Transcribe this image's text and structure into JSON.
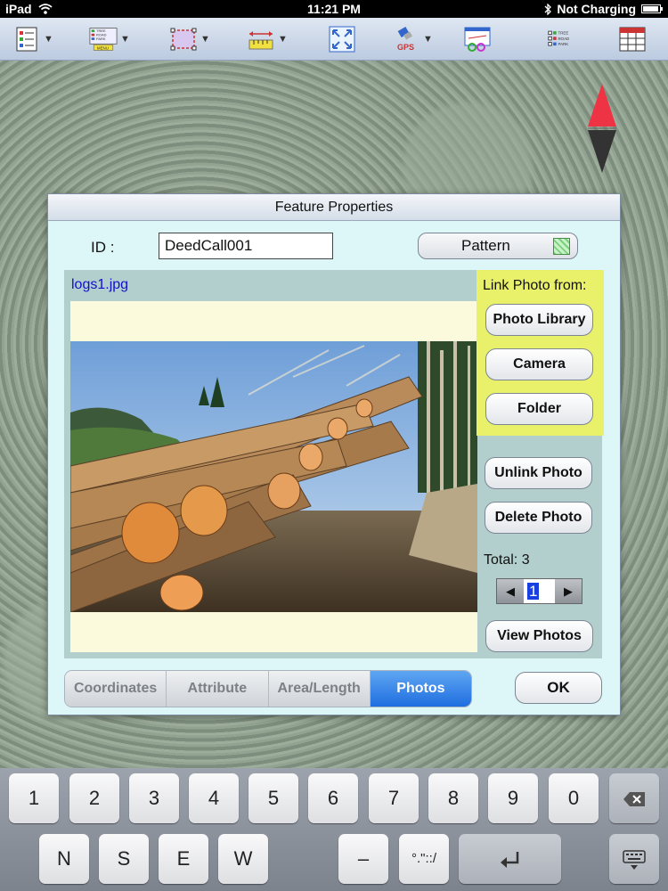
{
  "status_bar": {
    "device": "iPad",
    "time": "11:21 PM",
    "charging": "Not Charging"
  },
  "toolbar": {
    "items": [
      {
        "icon": "tree-list-icon",
        "dropdown": true
      },
      {
        "icon": "layer-menu-icon",
        "dropdown": true,
        "sub_labels": [
          "TREE",
          "ROAD",
          "PARK"
        ],
        "caption": "MENU"
      },
      {
        "icon": "boundary-icon",
        "dropdown": true
      },
      {
        "icon": "ruler-icon",
        "dropdown": true
      },
      {
        "icon": "zoom-extent-icon",
        "dropdown": false
      },
      {
        "icon": "gps-icon",
        "dropdown": true,
        "caption": "GPS"
      },
      {
        "icon": "map-settings-icon",
        "dropdown": false
      },
      {
        "icon": "layer-checklist-icon",
        "dropdown": false,
        "sub_labels": [
          "TREE",
          "ROAD",
          "PARK"
        ]
      },
      {
        "icon": "table-icon",
        "dropdown": false
      }
    ]
  },
  "dialog": {
    "title": "Feature Properties",
    "id_label": "ID :",
    "id_value": "DeedCall001",
    "pattern_label": "Pattern",
    "photo_filename": "logs1.jpg",
    "link_title": "Link Photo from:",
    "photo_library": "Photo Library",
    "camera": "Camera",
    "folder": "Folder",
    "unlink": "Unlink Photo",
    "delete": "Delete Photo",
    "total": "Total: 3",
    "stepper_value": "1",
    "view_photos": "View Photos",
    "tabs": [
      "Coordinates",
      "Attribute",
      "Area/Length",
      "Photos"
    ],
    "active_tab": "Photos",
    "ok": "OK"
  },
  "keyboard": {
    "row1": [
      "1",
      "2",
      "3",
      "4",
      "5",
      "6",
      "7",
      "8",
      "9",
      "0"
    ],
    "row2": [
      "N",
      "S",
      "E",
      "W",
      "–",
      "°.\"::/"
    ]
  },
  "colors": {
    "link_panel": "#e9f06a",
    "dialog_bg": "#ddf6f8",
    "active_tab": "#2f7ee8",
    "compass_north": "#ee3344"
  }
}
